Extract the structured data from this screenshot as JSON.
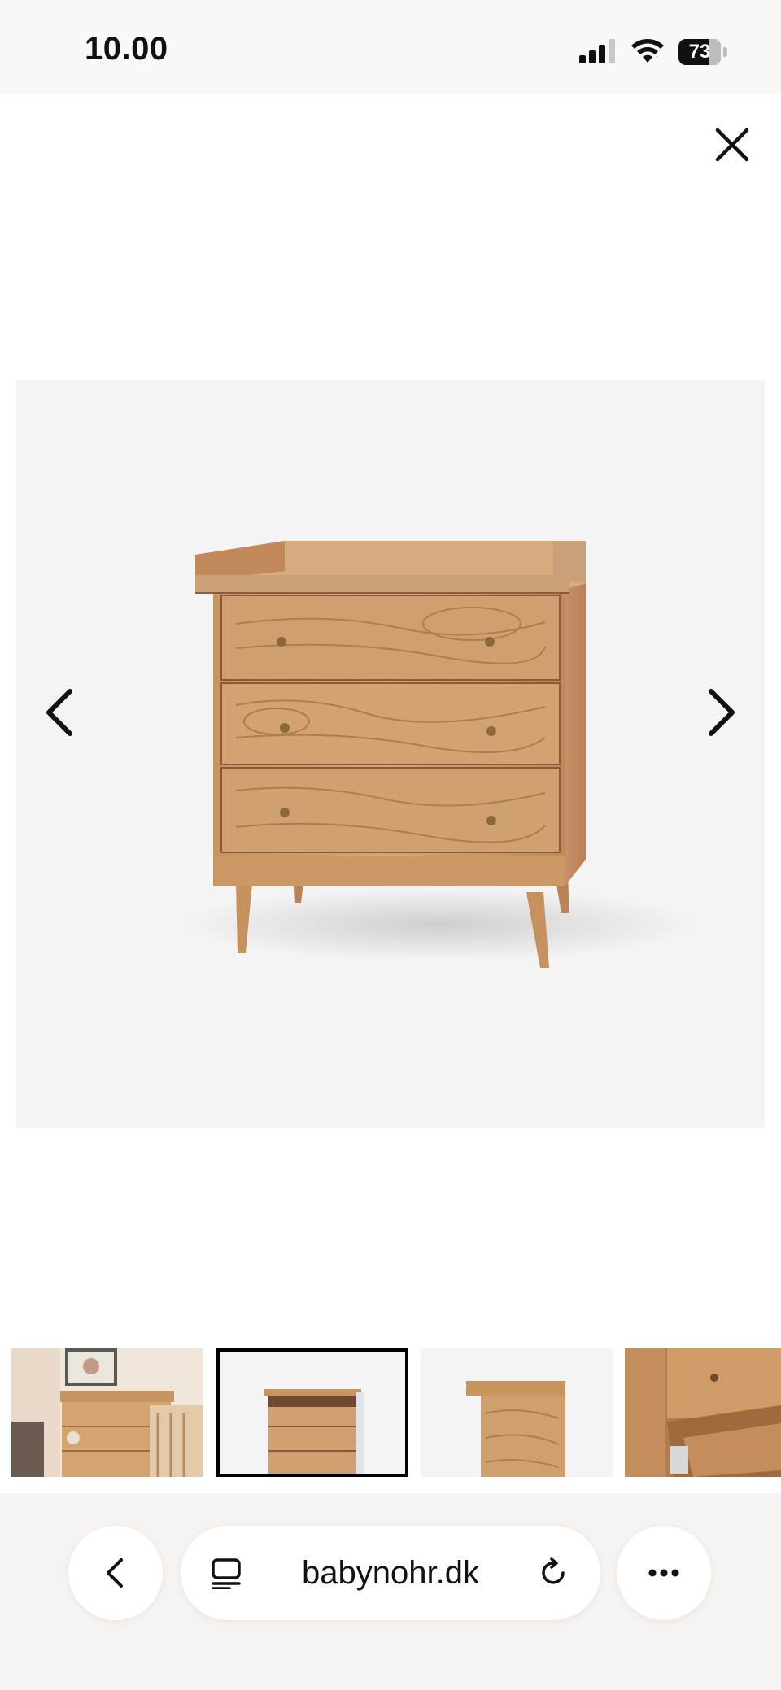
{
  "status_bar": {
    "time": "10.00",
    "battery": "73",
    "battery_level": 0.73,
    "icons": [
      "cellular-signal-icon",
      "wifi-icon",
      "battery-icon"
    ]
  },
  "viewer": {
    "close_icon": "close-icon",
    "prev_icon": "chevron-left-icon",
    "next_icon": "chevron-right-icon",
    "image_background": "#f4f4f4",
    "thumbnails": [
      {
        "selected": false
      },
      {
        "selected": true
      },
      {
        "selected": false
      },
      {
        "selected": false
      }
    ]
  },
  "browser_bar": {
    "url": "babynohr.dk",
    "back_icon": "chevron-left-icon",
    "reader_icon": "reader-mode-icon",
    "reload_icon": "reload-icon",
    "more_icon": "more-icon"
  },
  "colors": {
    "wood": "#c28a5c",
    "wood_dark": "#9c6a43",
    "background": "#f4f4f4",
    "selected_border": "#000000"
  }
}
